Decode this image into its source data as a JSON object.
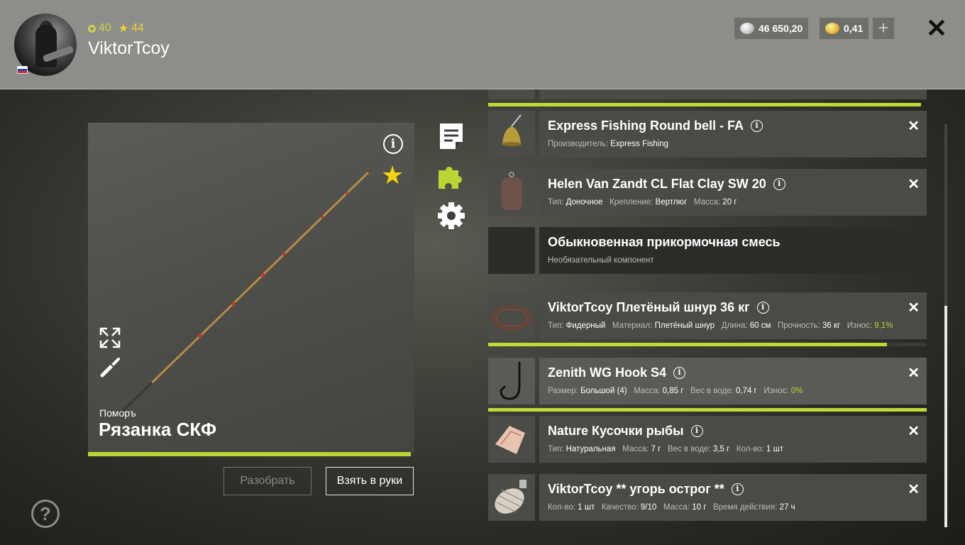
{
  "player": {
    "level_a": "40",
    "level_b": "44",
    "name": "ViktorTcoy",
    "flag": "ru"
  },
  "currency": {
    "silver": "46 650,20",
    "gold": "0,41",
    "add_label": "+"
  },
  "rod": {
    "brand": "Поморъ",
    "name": "Рязанка СКФ",
    "progress": 0.99,
    "dismantle_label": "Разобрать",
    "take_label": "Взять в руки"
  },
  "help_label": "?",
  "items": [
    {
      "title": "Express Fishing Round bell - FA",
      "meta": [
        {
          "k": "Производитель:",
          "v": "Express Fishing"
        }
      ],
      "removable": true,
      "progress": null
    },
    {
      "title": "Helen Van Zandt CL Flat Clay SW 20",
      "meta": [
        {
          "k": "Тип:",
          "v": "Доночное"
        },
        {
          "k": "Крепление:",
          "v": "Вертлюг"
        },
        {
          "k": "Масса:",
          "v": "20 г"
        }
      ],
      "removable": true,
      "progress": null
    },
    {
      "title": "Обыкновенная прикормочная смесь",
      "meta_text": "Необязательный компонент",
      "removable": false,
      "progress": null
    },
    {
      "title": "ViktorTcoy Плетёный шнур 36 кг",
      "meta": [
        {
          "k": "Тип:",
          "v": "Фидерный"
        },
        {
          "k": "Материал:",
          "v": "Плетёный шнур"
        },
        {
          "k": "Длина:",
          "v": "60 см"
        },
        {
          "k": "Прочность:",
          "v": "36 кг"
        },
        {
          "k": "Износ:",
          "v": "9,1%",
          "wear": true
        }
      ],
      "removable": true,
      "progress": 0.91
    },
    {
      "title": "Zenith WG Hook S4",
      "meta": [
        {
          "k": "Размер:",
          "v": "Большой (4)"
        },
        {
          "k": "Масса:",
          "v": "0,85 г"
        },
        {
          "k": "Вес в воде:",
          "v": "0,74 г"
        },
        {
          "k": "Износ:",
          "v": "0%",
          "wear": true
        }
      ],
      "removable": true,
      "progress": 1.0
    },
    {
      "title": "Nature Кусочки рыбы",
      "meta": [
        {
          "k": "Тип:",
          "v": "Натуральная"
        },
        {
          "k": "Масса:",
          "v": "7 г"
        },
        {
          "k": "Вес в воде:",
          "v": "3,5 г"
        },
        {
          "k": "Кол-во:",
          "v": "1 шт"
        }
      ],
      "removable": true,
      "progress": null
    },
    {
      "title": "ViktorTcoy ** угорь острог **",
      "meta": [
        {
          "k": "Кол-во:",
          "v": "1 шт"
        },
        {
          "k": "Качество:",
          "v": "9/10"
        },
        {
          "k": "Масса:",
          "v": "10 г"
        },
        {
          "k": "Время действия:",
          "v": "27 ч"
        }
      ],
      "removable": true,
      "progress": null
    }
  ],
  "colors": {
    "accent": "#c2d838",
    "star": "#f5d20f",
    "level_green": "#c8d44a"
  },
  "icons": [
    "info-icon",
    "star-icon",
    "expand-icon",
    "tool-icon",
    "document-icon",
    "puzzle-icon",
    "gear-icon",
    "close-icon",
    "help-icon",
    "silver-coin-icon",
    "gold-coin-icon"
  ]
}
